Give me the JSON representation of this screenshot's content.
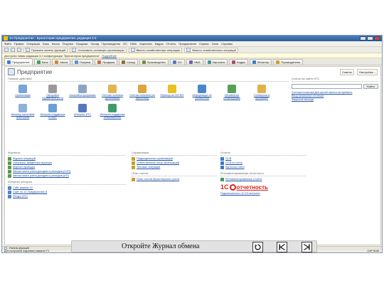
{
  "window": {
    "title": "1С:Предприятие - Бухгалтерия предприятия, редакция 3.0"
  },
  "menu": [
    "Файл",
    "Правка",
    "Операции",
    "Банк",
    "Касса",
    "Покупка",
    "Продажа",
    "Склад",
    "Производство",
    "ОС",
    "НМА",
    "Зарплата",
    "Кадры",
    "Отчеты",
    "Предприятие",
    "Сервис",
    "Окна",
    "Справка"
  ],
  "toolbar": {
    "panel_button": "Показать панель функций",
    "org_button": "Установить основную организацию",
    "op_button": "Ввести хозяйственную операцию",
    "setup_button": "Вместо хозяйственных операций"
  },
  "infobar": {
    "text": "Доступна новая редакция 3.0 конфигурации \"Бухгалтерия предприятия\"",
    "link": "Подробнее"
  },
  "sections": [
    {
      "label": "Предприятие",
      "color": "#3e7bc9"
    },
    {
      "label": "Банк",
      "color": "#4a9d4a"
    },
    {
      "label": "Касса",
      "color": "#c98a2e"
    },
    {
      "label": "Покупка",
      "color": "#5a8fd0"
    },
    {
      "label": "Продажа",
      "color": "#d06a3a"
    },
    {
      "label": "Склад",
      "color": "#8a6d3b"
    },
    {
      "label": "Производство",
      "color": "#6d8f3b"
    },
    {
      "label": "ОС",
      "color": "#4f7fb7"
    },
    {
      "label": "НМА",
      "color": "#7a5db0"
    },
    {
      "label": "Зарплата",
      "color": "#3b9a8f"
    },
    {
      "label": "Кадры",
      "color": "#b04a6d"
    },
    {
      "label": "Монитор",
      "color": "#3e7bc9"
    },
    {
      "label": "Руководителю",
      "color": "#c9a02e"
    }
  ],
  "page": {
    "title": "Предприятие",
    "actions": [
      "Советы",
      "Настройка..."
    ]
  },
  "common": {
    "heading": "Главное действия",
    "items": [
      {
        "label": "Организации",
        "icon": "building-icon",
        "color": "#7aa3d6"
      },
      {
        "label": "Настройка параметров учета",
        "icon": "gear-icon",
        "color": "#9a9a9a"
      },
      {
        "label": "Настройка программы",
        "icon": "tools-icon",
        "color": "#8aa6c4"
      },
      {
        "label": "Учетная политика организаций",
        "icon": "document-icon",
        "color": "#e0b650"
      },
      {
        "label": "Учетная политика (по персоналу)",
        "icon": "people-icon",
        "color": "#d9a640"
      },
      {
        "label": "Переход на ОКТМО",
        "icon": "warning-icon",
        "color": "#e8c020"
      },
      {
        "label": "Информация об обновлении",
        "icon": "globe-icon",
        "color": "#4a87c9"
      },
      {
        "label": "Обновление конфигурации",
        "icon": "refresh-icon",
        "color": "#58a05a"
      },
      {
        "label": "Сообщения в программе",
        "icon": "mail-icon",
        "color": "#e2b14a"
      },
      {
        "label": "Монитор налоговой отчетности",
        "icon": "monitor-icon",
        "color": "#8fb0d8"
      },
      {
        "label": "Интернет-поддержка ЕГАИС",
        "icon": "network-icon",
        "color": "#6aa0d2"
      },
      {
        "label": "Интернет-ИТС",
        "icon": "its-icon",
        "color": "#5577bb"
      },
      {
        "label": "Интернет-поддержка пользователей",
        "icon": "support-icon",
        "color": "#3f9a6a"
      }
    ]
  },
  "side": {
    "heading": "Статьи на сайте ИТС",
    "search_button": "Найти",
    "links": [
      "Учетная политика для целей налога на прибыль",
      "Ввод начальных остатков",
      "Закрытие месяца"
    ]
  },
  "journals": {
    "heading": "Журналы",
    "items": [
      "Журнал операций",
      "Операции, введенные вручную",
      "Журнал проводок",
      "Запись книги учета доходов и расходов (УСН)",
      "Запись книги учета доходов и расходов (ИП)"
    ]
  },
  "internet": {
    "heading": "Интернет-ресурсы",
    "items": [
      "Сайт фирмы 1С",
      "Сайт по 1С:Предприятию 8",
      "Ресурс ИТС"
    ]
  },
  "directories": {
    "heading": "Справочники",
    "items": [
      "Подразделения организаций",
      "Ответственные лица организаций",
      "Типовые операции"
    ]
  },
  "accounts": {
    "heading": "План счетов",
    "items": [
      "План счетов бухгалтерского учета"
    ]
  },
  "reports": {
    "heading": "Отчеты",
    "items": [
      "ОСВ",
      "ОСВ по счету",
      "Карточка счета"
    ]
  },
  "regulated": {
    "heading": "Регламентированная отчетность",
    "items": [
      "Регламентированные отчеты"
    ],
    "brand_one": "1С",
    "brand_rest": "отчетность",
    "connect_link": "Подключиться к 1С:Отчетности"
  },
  "status": {
    "tab": "Панель функций",
    "hint": "Для получения подсказки нажмите F1",
    "right": "CAP NUM"
  },
  "caption": {
    "text": "Откройте Журнал обмена"
  },
  "colors": {
    "accent": "#1d4fa3",
    "title_bar": "#2c5d9b",
    "brand_red": "#d6201b"
  }
}
